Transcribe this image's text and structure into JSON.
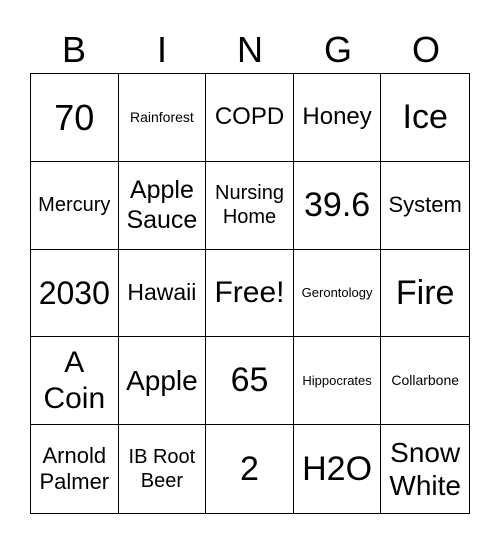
{
  "header": [
    "B",
    "I",
    "N",
    "G",
    "O"
  ],
  "cells": [
    "70",
    "Rainforest",
    "COPD",
    "Honey",
    "Ice",
    "Mercury",
    "Apple Sauce",
    "Nursing Home",
    "39.6",
    "System",
    "2030",
    "Hawaii",
    "Free!",
    "Gerontology",
    "Fire",
    "A Coin",
    "Apple",
    "65",
    "Hippocrates",
    "Collarbone",
    "Arnold Palmer",
    "IB Root Beer",
    "2",
    "H2O",
    "Snow White"
  ]
}
